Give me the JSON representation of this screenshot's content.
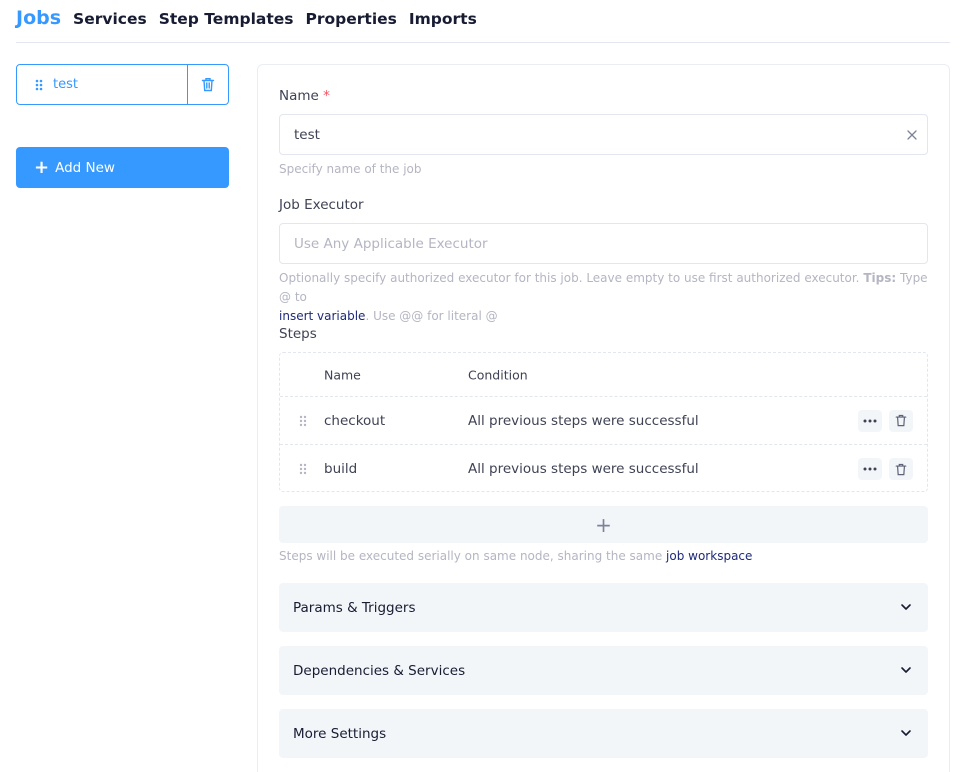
{
  "nav": {
    "tabs": [
      {
        "label": "Jobs",
        "active": true
      },
      {
        "label": "Services"
      },
      {
        "label": "Step Templates"
      },
      {
        "label": "Properties"
      },
      {
        "label": "Imports"
      }
    ]
  },
  "job_list": {
    "items": [
      {
        "label": "test",
        "icon": "grip-icon"
      }
    ],
    "delete_icon": "trash-icon",
    "add_label": "Add New",
    "add_icon": "plus-icon"
  },
  "form": {
    "name": {
      "label": "Name",
      "required_mark": "*",
      "value": "test",
      "hint": "Specify name of the job"
    },
    "executor": {
      "label": "Job Executor",
      "placeholder": "Use Any Applicable Executor",
      "hint_prefix": "Optionally specify authorized executor for this job. Leave empty to use first authorized executor.",
      "tips_label": "Tips:",
      "tips_text": "Type @ to",
      "insert_variable_link": "insert variable",
      "literal_text": ". Use @@ for literal @"
    },
    "steps": {
      "label": "Steps",
      "columns": [
        "Name",
        "Condition"
      ],
      "rows": [
        {
          "name": "checkout",
          "condition": "All previous steps were successful"
        },
        {
          "name": "build",
          "condition": "All previous steps were successful"
        }
      ],
      "add_symbol": "+",
      "hint_prefix": "Steps will be executed serially on same node, sharing the same",
      "hint_link": "job workspace"
    },
    "sections": [
      {
        "label": "Params & Triggers",
        "icon": "chevron-down-icon"
      },
      {
        "label": "Dependencies & Services",
        "icon": "chevron-down-icon"
      },
      {
        "label": "More Settings",
        "icon": "chevron-down-icon"
      }
    ]
  },
  "colors": {
    "accent": "#3699ff",
    "required": "#f64e60",
    "muted": "#b5b5c3",
    "link": "#1e2a78",
    "section_bg": "#f3f6f9"
  }
}
